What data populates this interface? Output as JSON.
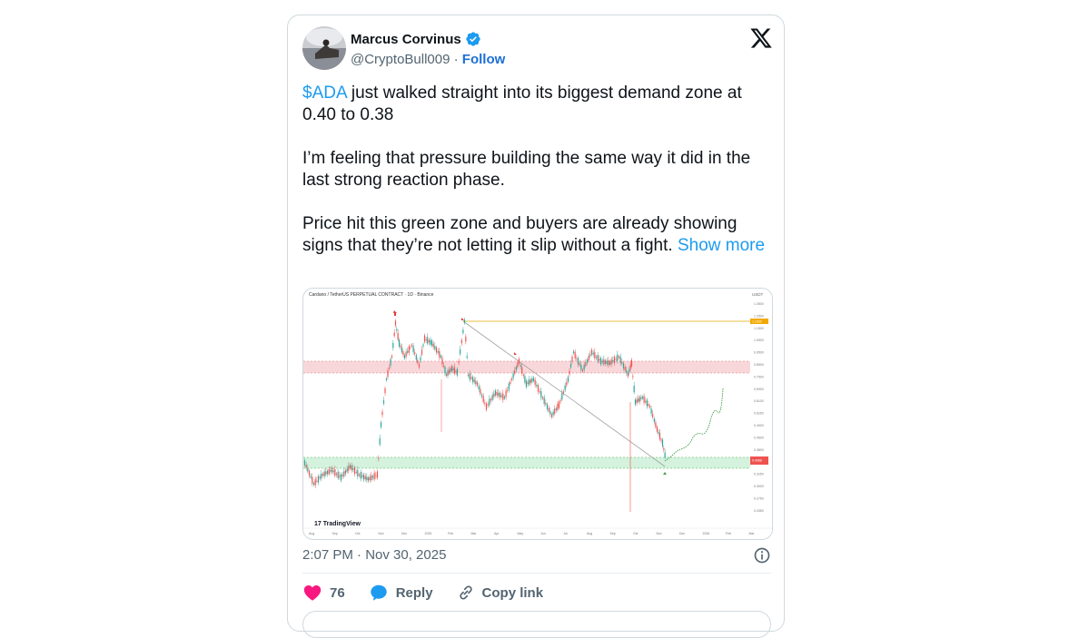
{
  "author": {
    "name": "Marcus Corvinus",
    "handle": "@CryptoBull009",
    "separator": "·",
    "follow_label": "Follow",
    "verified_icon": "verified-badge-icon",
    "avatar_alt": "profile-photo"
  },
  "tweet": {
    "ticker": "$ADA",
    "line1_rest": " just walked straight into its biggest demand zone at 0.40 to 0.38",
    "para2": "I’m feeling that pressure building the same way it did in the last strong reaction phase.",
    "para3": "Price hit this green zone and buyers are already showing signs that they’re not letting it slip without a fight. ",
    "show_more": "Show more"
  },
  "chart": {
    "header": "Cardano / TetherUS PERPETUAL CONTRACT · 1D · Binance",
    "currency": "USDT",
    "watermark": "TradingView",
    "x_ticks": [
      "Aug",
      "Sep",
      "Oct",
      "Nov",
      "Dec",
      "2025",
      "Feb",
      "Mar",
      "Apr",
      "May",
      "Jun",
      "Jul",
      "Aug",
      "Sep",
      "Oct",
      "Nov",
      "Dec",
      "2026",
      "Feb",
      "Mar"
    ],
    "y_ticks": [
      "1.3500",
      "1.2500",
      "1.1500",
      "1.0500",
      "0.9500",
      "0.8500",
      "0.7500",
      "0.6900",
      "0.6100",
      "0.5250",
      "0.4900",
      "0.4500",
      "0.3800",
      "0.3500",
      "0.3250",
      "0.3000",
      "0.2750",
      "0.2550"
    ],
    "resistance_price": "1.1500",
    "current_price": "0.4088",
    "colors": {
      "bull": "#26a69a",
      "bear": "#ef5350",
      "resistance_zone": "#f8d7da",
      "demand_zone": "#d4f2dd",
      "trend_line": "#9e9e9e",
      "target_line": "#e0a800"
    }
  },
  "meta": {
    "timestamp": "2:07 PM · Nov 30, 2025"
  },
  "actions": {
    "likes": "76",
    "reply_label": "Reply",
    "copy_label": "Copy link"
  }
}
